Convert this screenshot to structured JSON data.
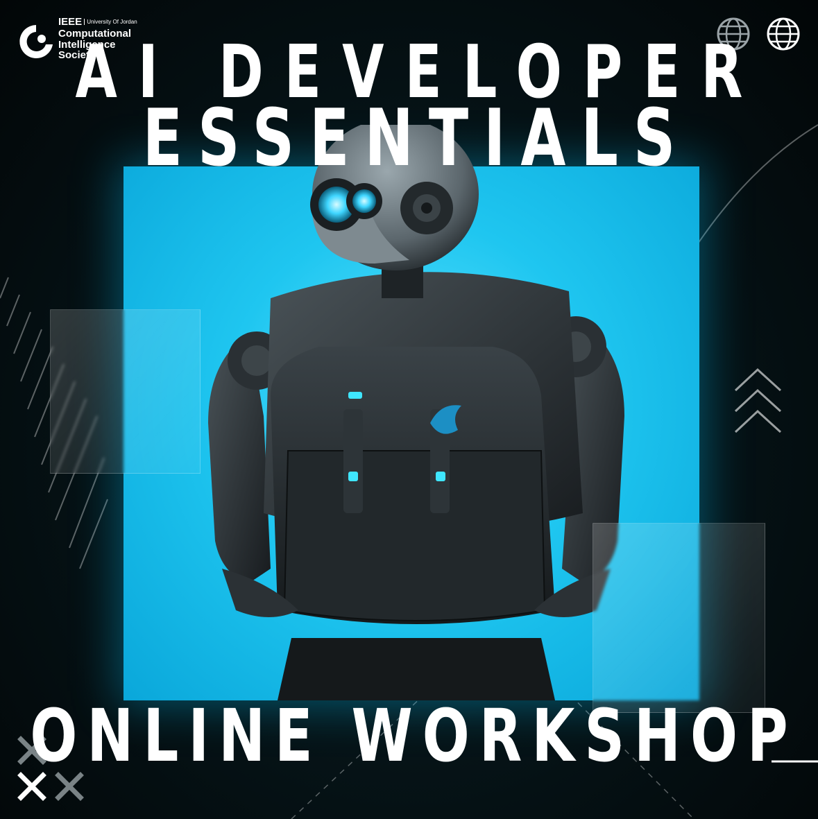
{
  "logo": {
    "org": "IEEE",
    "university": "University Of Jordan",
    "society_line1": "Computational",
    "society_line2": "Intelligence",
    "society_line3": "Society"
  },
  "headline": {
    "line1": "AI DEVELOPER",
    "line2": "ESSENTIALS"
  },
  "footer": {
    "label": "ONLINE WORKSHOP"
  },
  "colors": {
    "accent": "#1fc6f0",
    "background": "#061418",
    "text": "#ffffff"
  },
  "icons": [
    "ieee-cis-logo-icon",
    "globe-icon",
    "globe-icon",
    "chevron-up-icon",
    "x-mark-icon"
  ]
}
